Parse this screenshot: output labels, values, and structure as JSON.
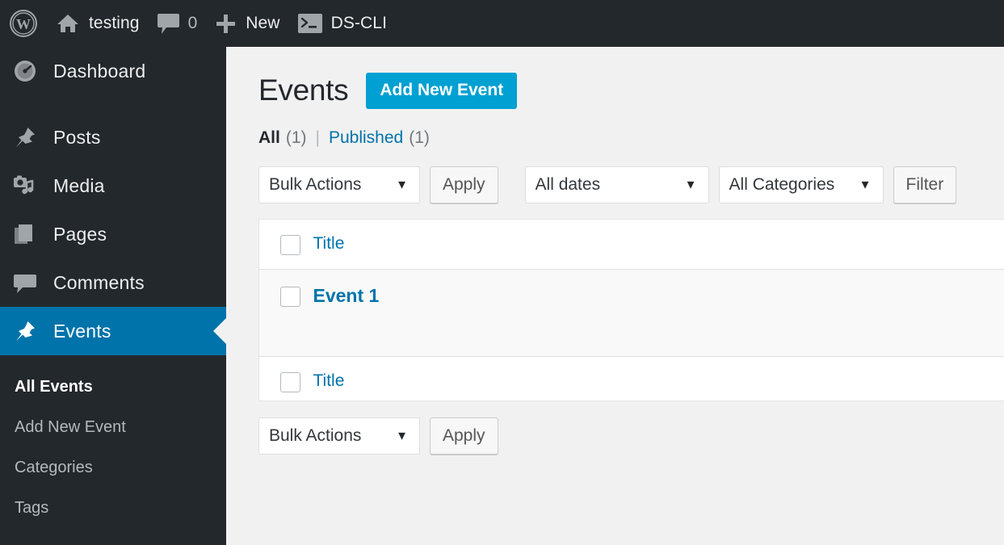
{
  "adminbar": {
    "logo_icon": "wordpress-logo-icon",
    "site_icon": "home-icon",
    "site_name": "testing",
    "comments_icon": "comment-bubble-icon",
    "comments_count": "0",
    "new_icon": "plus-icon",
    "new_label": "New",
    "cli_icon": "terminal-icon",
    "cli_label": "DS-CLI"
  },
  "sidebar": {
    "items": [
      {
        "label": "Dashboard",
        "icon": "dashboard-gauge-icon",
        "current": false
      },
      {
        "label": "Posts",
        "icon": "pushpin-icon",
        "current": false
      },
      {
        "label": "Media",
        "icon": "media-camera-music-icon",
        "current": false
      },
      {
        "label": "Pages",
        "icon": "pages-stack-icon",
        "current": false
      },
      {
        "label": "Comments",
        "icon": "comment-bubble-icon",
        "current": false
      },
      {
        "label": "Events",
        "icon": "pushpin-icon",
        "current": true
      }
    ],
    "submenu": [
      {
        "label": "All Events",
        "current": true
      },
      {
        "label": "Add New Event",
        "current": false
      },
      {
        "label": "Categories",
        "current": false
      },
      {
        "label": "Tags",
        "current": false
      }
    ]
  },
  "page": {
    "title": "Events",
    "add_new_label": "Add New Event"
  },
  "filters": {
    "all_label": "All",
    "all_count": "(1)",
    "separator": "|",
    "published_label": "Published",
    "published_count": "(1)"
  },
  "tablenav_top": {
    "bulk_actions_value": "Bulk Actions",
    "apply_label": "Apply",
    "dates_value": "All dates",
    "categories_value": "All Categories",
    "filter_label": "Filter",
    "caret": "▼"
  },
  "tablenav_bottom": {
    "bulk_actions_value": "Bulk Actions",
    "apply_label": "Apply",
    "caret": "▼"
  },
  "table": {
    "header_title": "Title",
    "footer_title": "Title",
    "rows": [
      {
        "title": "Event 1"
      }
    ]
  },
  "colors": {
    "admin_bg": "#23282d",
    "current_menu": "#0073aa",
    "button_primary": "#00a0d2",
    "link": "#0073aa",
    "content_bg": "#f1f1f1"
  }
}
